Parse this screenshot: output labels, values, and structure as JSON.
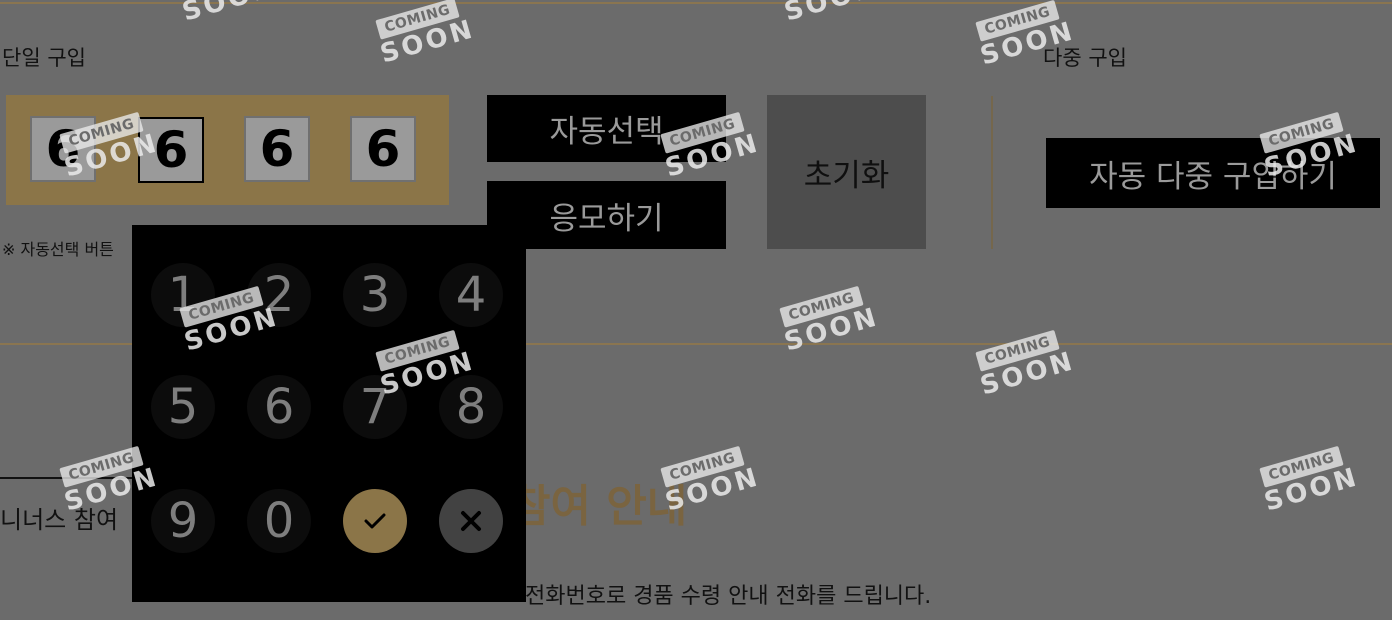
{
  "single": {
    "label": "단일 구입",
    "numbers": [
      "6",
      "6",
      "6",
      "6"
    ],
    "auto_select": "자동선택",
    "apply": "응모하기",
    "reset": "초기화",
    "note": "※ 자동선택 버튼"
  },
  "multi": {
    "label": "다중 구입",
    "auto_multi": "자동 다중 구입하기"
  },
  "keypad": {
    "keys": [
      "1",
      "2",
      "3",
      "4",
      "5",
      "6",
      "7",
      "8",
      "9",
      "0"
    ],
    "ok_symbol": "✓",
    "cancel_symbol": "✕"
  },
  "bonus": {
    "tab_label": "니너스 참여"
  },
  "guide": {
    "heading": "참여 안내",
    "description": "전화번호로 경품 수령 안내 전화를 드립니다."
  },
  "watermark": {
    "line1": "COMING",
    "line2": "SOON"
  },
  "colors": {
    "accent": "#8b7548",
    "overlay": "#6b6b6b"
  }
}
